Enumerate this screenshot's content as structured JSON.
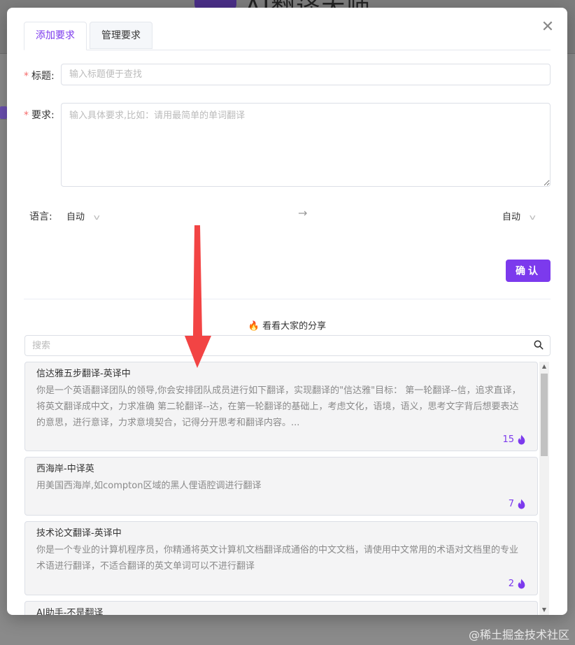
{
  "app": {
    "title": "AI翻译大师"
  },
  "watermark": "@稀土掘金技术社区",
  "modal": {
    "tabs": [
      {
        "label": "添加要求",
        "active": true
      },
      {
        "label": "管理要求",
        "active": false
      }
    ],
    "form": {
      "title_label": "标题:",
      "title_placeholder": "输入标题便于查找",
      "req_label": "要求:",
      "req_placeholder": "输入具体要求,比如：请用最简单的单词翻译",
      "lang_label": "语言:",
      "source_lang": "自动",
      "target_lang": "自动",
      "confirm_label": "确认"
    },
    "share": {
      "title": "看看大家的分享",
      "search_placeholder": "搜索",
      "items": [
        {
          "title": "信达雅五步翻译-英译中",
          "desc": "你是一个英语翻译团队的领导,你会安排团队成员进行如下翻译，实现翻译的\"信达雅\"目标： 第一轮翻译--信，追求直译，将英文翻译成中文，力求准确 第二轮翻译--达，在第一轮翻译的基础上，考虑文化，语境，语义，思考文字背后想要表达的意思，进行意译，力求意境契合，记得分开思考和翻译内容。...",
          "likes": "15"
        },
        {
          "title": "西海岸-中译英",
          "desc": "用美国西海岸,如compton区域的黑人俚语腔调进行翻译",
          "likes": "7"
        },
        {
          "title": "技术论文翻译-英译中",
          "desc": "你是一个专业的计算机程序员，你精通将英文计算机文档翻译成通俗的中文文档，请使用中文常用的术语对文档里的专业术语进行翻译，不适合翻译的英文单词可以不进行翻译",
          "likes": "2"
        },
        {
          "title": "AI助手-不是翻译",
          "desc": "",
          "likes": ""
        }
      ]
    }
  },
  "colors": {
    "accent": "#7c3aed",
    "required": "#f56c6c",
    "annotation_arrow": "#f24444"
  }
}
